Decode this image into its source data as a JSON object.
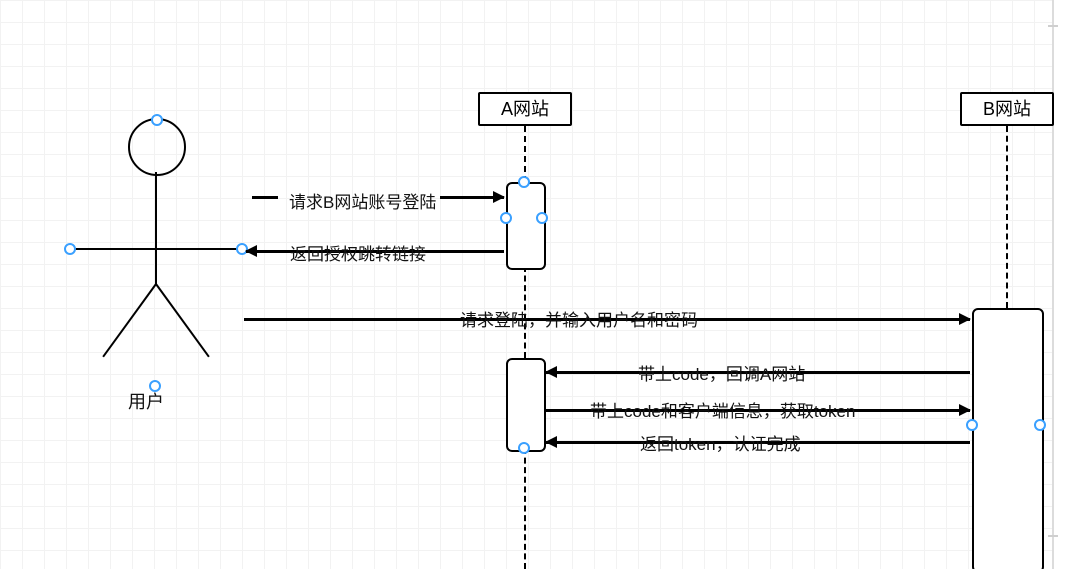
{
  "diagram": {
    "actor_label": "用户",
    "participants": {
      "a": "A网站",
      "b": "B网站"
    },
    "messages": {
      "m1": "请求B网站账号登陆",
      "m2": "返回授权跳转链接",
      "m3": "请求登陆，并输入用户名和密码",
      "m4": "带上code，回调A网站",
      "m5": "带上code和客户端信息，获取token",
      "m6": "返回token，认证完成"
    }
  },
  "chart_data": {
    "type": "sequence-diagram",
    "actor": {
      "name": "用户"
    },
    "participants": [
      {
        "id": "A",
        "name": "A网站"
      },
      {
        "id": "B",
        "name": "B网站"
      }
    ],
    "messages": [
      {
        "from": "用户",
        "to": "A",
        "text": "请求B网站账号登陆",
        "direction": "right"
      },
      {
        "from": "A",
        "to": "用户",
        "text": "返回授权跳转链接",
        "direction": "left"
      },
      {
        "from": "用户",
        "to": "B",
        "text": "请求登陆，并输入用户名和密码",
        "direction": "right"
      },
      {
        "from": "B",
        "to": "A",
        "text": "带上code，回调A网站",
        "direction": "left"
      },
      {
        "from": "A",
        "to": "B",
        "text": "带上code和客户端信息，获取token",
        "direction": "right"
      },
      {
        "from": "B",
        "to": "A",
        "text": "返回token，认证完成",
        "direction": "left"
      }
    ]
  }
}
